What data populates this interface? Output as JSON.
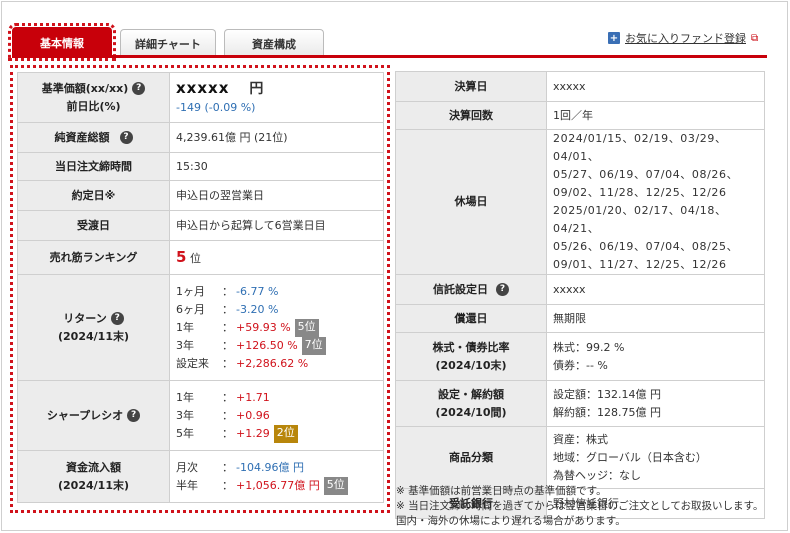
{
  "tabs": [
    "基本情報",
    "詳細チャート",
    "資産構成"
  ],
  "favorite": {
    "icon": "plus-square-icon",
    "label": "お気に入りファンド登録",
    "ext_icon": "external-link-icon"
  },
  "left": {
    "price": {
      "label": "基準価額(xx/xx)",
      "label2": "前日比(%)",
      "value": "xxxxx",
      "unit": "円",
      "change": "-149 (-0.09 %)"
    },
    "net_assets": {
      "label": "純資産総額",
      "value": "4,239.61億 円 (21位)"
    },
    "cutoff": {
      "label": "当日注文締時間",
      "value": "15:30"
    },
    "contract_day": {
      "label": "約定日※",
      "value": "申込日の翌営業日"
    },
    "delivery_day": {
      "label": "受渡日",
      "value": "申込日から起算して6営業日目"
    },
    "ranking": {
      "label": "売れ筋ランキング",
      "value": "5",
      "unit": "位"
    },
    "returns": {
      "label": "リターン",
      "label2": "(2024/11末)",
      "rows": [
        {
          "period": "1ヶ月",
          "colon": "：",
          "value": "-6.77 %",
          "badge": ""
        },
        {
          "period": "6ヶ月",
          "colon": "：",
          "value": "-3.20 %",
          "badge": ""
        },
        {
          "period": "1年",
          "colon": "：",
          "value": "+59.93 %",
          "badge": "5位"
        },
        {
          "period": "3年",
          "colon": "：",
          "value": "+126.50 %",
          "badge": "7位"
        },
        {
          "period": "設定来",
          "colon": "：",
          "value": "+2,286.62 %",
          "badge": ""
        }
      ]
    },
    "sharpe": {
      "label": "シャープレシオ",
      "rows": [
        {
          "period": "1年",
          "colon": "：",
          "value": "+1.71",
          "badge": ""
        },
        {
          "period": "3年",
          "colon": "：",
          "value": "+0.96",
          "badge": ""
        },
        {
          "period": "5年",
          "colon": "：",
          "value": "+1.29",
          "badge": "2位"
        }
      ]
    },
    "flows": {
      "label": "資金流入額",
      "label2": "(2024/11末)",
      "rows": [
        {
          "period": "月次",
          "colon": "：",
          "value": "-104.96億 円",
          "badge": ""
        },
        {
          "period": "半年",
          "colon": "：",
          "value": "+1,056.77億 円",
          "badge": "5位"
        }
      ]
    }
  },
  "right": {
    "settlement_day": {
      "label": "決算日",
      "value": "xxxxx"
    },
    "settlement_count": {
      "label": "決算回数",
      "value": "1回／年"
    },
    "holidays": {
      "label": "休場日",
      "lines": [
        "2024/01/15、02/19、03/29、04/01、",
        "05/27、06/19、07/04、08/26、",
        "09/02、11/28、12/25、12/26",
        "2025/01/20、02/17、04/18、04/21、",
        "05/26、06/19、07/04、08/25、",
        "09/01、11/27、12/25、12/26"
      ]
    },
    "inception": {
      "label": "信託設定日",
      "value": "xxxxx"
    },
    "maturity": {
      "label": "償還日",
      "value": "無期限"
    },
    "ratio": {
      "label": "株式・債券比率",
      "label2": "(2024/10末)",
      "line1": "株式：99.2 %",
      "line2": "債券：-- %"
    },
    "subs": {
      "label": "設定・解約額",
      "label2": "(2024/10間)",
      "line1": "設定額：132.14億 円",
      "line2": "解約額：128.75億 円"
    },
    "category": {
      "label": "商品分類",
      "line1": "資産：株式",
      "line2": "地域：グローバル（日本含む）",
      "line3": "為替ヘッジ：なし"
    },
    "trustee": {
      "label": "受託銀行",
      "value": "野村信託銀行"
    }
  },
  "notes": [
    "※ 基準価額は前営業日時点の基準価額です。",
    "※ 当日注文締め時間を過ぎてからは翌営業日のご注文としてお取扱いします。国内・海外の休場により遅れる場合があります。"
  ],
  "colors": {
    "accent": "#c8000a",
    "positive": "#d0121b",
    "negative": "#2f6fb3",
    "header_bg": "#ececec"
  }
}
